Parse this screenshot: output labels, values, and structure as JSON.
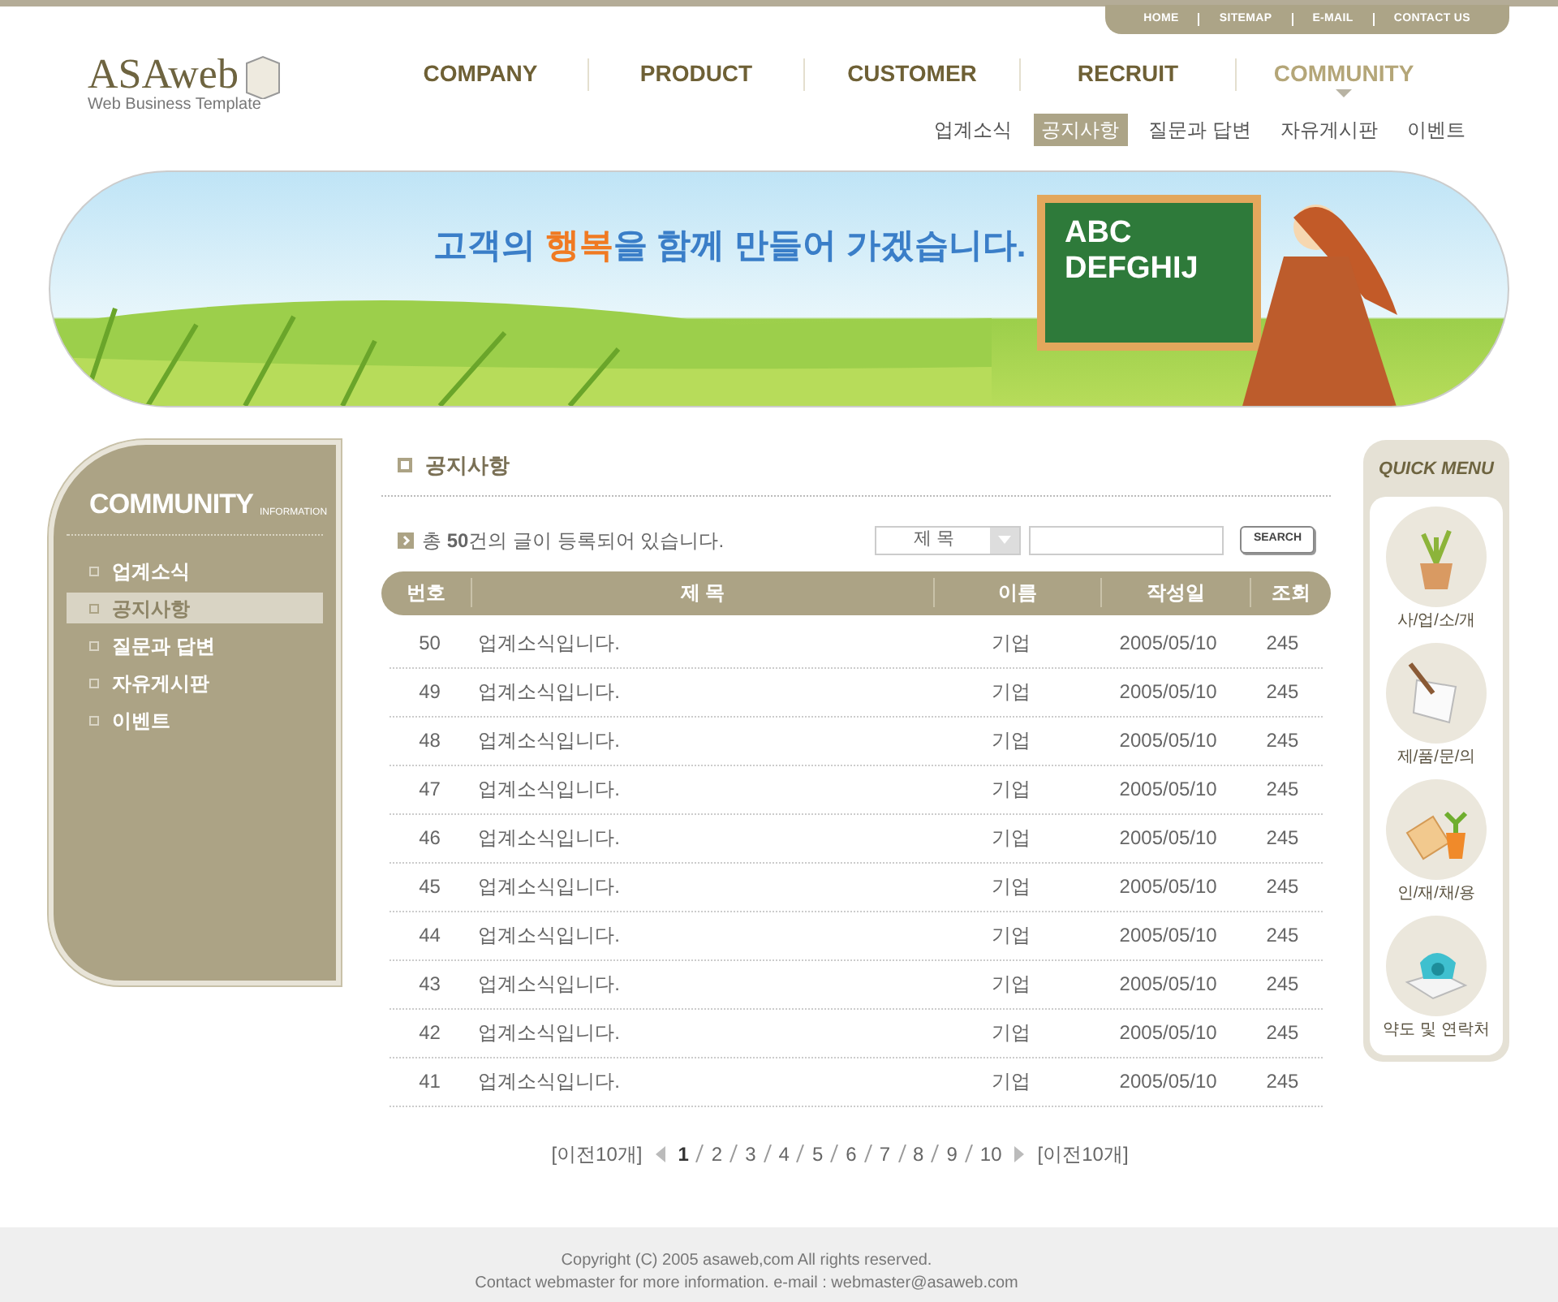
{
  "top_links": [
    "HOME",
    "SITEMAP",
    "E-MAIL",
    "CONTACT US"
  ],
  "logo": {
    "name": "ASAweb",
    "tagline": "Web Business Template"
  },
  "nav": [
    {
      "label": "COMPANY",
      "selected": false
    },
    {
      "label": "PRODUCT",
      "selected": false
    },
    {
      "label": "CUSTOMER",
      "selected": false
    },
    {
      "label": "RECRUIT",
      "selected": false
    },
    {
      "label": "COMMUNITY",
      "selected": true
    }
  ],
  "subnav": [
    {
      "label": "업계소식",
      "selected": false
    },
    {
      "label": "공지사항",
      "selected": true
    },
    {
      "label": "질문과 답변",
      "selected": false
    },
    {
      "label": "자유게시판",
      "selected": false
    },
    {
      "label": "이벤트",
      "selected": false
    }
  ],
  "banner": {
    "headline": [
      {
        "text": "고객의 ",
        "highlight": false
      },
      {
        "text": "행복",
        "highlight": true
      },
      {
        "text": "을 함께 만들어 가겠습니다.",
        "highlight": false
      }
    ],
    "board_lines": [
      "ABC",
      "DEFGHIJ"
    ]
  },
  "sidebar": {
    "title": "COMMUNITY",
    "subtitle": "INFORMATION",
    "items": [
      {
        "label": "업계소식",
        "selected": false
      },
      {
        "label": "공지사항",
        "selected": true
      },
      {
        "label": "질문과 답변",
        "selected": false
      },
      {
        "label": "자유게시판",
        "selected": false
      },
      {
        "label": "이벤트",
        "selected": false
      }
    ]
  },
  "board": {
    "title": "공지사항",
    "summary": "총 **50**건의 글이 등록되어 있습니다.",
    "search_select": "제 목",
    "search_button": "SEARCH",
    "columns": [
      "번호",
      "제 목",
      "이름",
      "작성일",
      "조회"
    ],
    "rows": [
      [
        "50",
        "업계소식입니다.",
        "기업",
        "2005/05/10",
        "245"
      ],
      [
        "49",
        "업계소식입니다.",
        "기업",
        "2005/05/10",
        "245"
      ],
      [
        "48",
        "업계소식입니다.",
        "기업",
        "2005/05/10",
        "245"
      ],
      [
        "47",
        "업계소식입니다.",
        "기업",
        "2005/05/10",
        "245"
      ],
      [
        "46",
        "업계소식입니다.",
        "기업",
        "2005/05/10",
        "245"
      ],
      [
        "45",
        "업계소식입니다.",
        "기업",
        "2005/05/10",
        "245"
      ],
      [
        "44",
        "업계소식입니다.",
        "기업",
        "2005/05/10",
        "245"
      ],
      [
        "43",
        "업계소식입니다.",
        "기업",
        "2005/05/10",
        "245"
      ],
      [
        "42",
        "업계소식입니다.",
        "기업",
        "2005/05/10",
        "245"
      ],
      [
        "41",
        "업계소식입니다.",
        "기업",
        "2005/05/10",
        "245"
      ]
    ],
    "pagination": {
      "prev": "[이전10개]",
      "next": "[이전10개]",
      "pages": [
        {
          "label": "1",
          "selected": true
        },
        {
          "label": "2",
          "selected": false
        },
        {
          "label": "3",
          "selected": false
        },
        {
          "label": "4",
          "selected": false
        },
        {
          "label": "5",
          "selected": false
        },
        {
          "label": "6",
          "selected": false
        },
        {
          "label": "7",
          "selected": false
        },
        {
          "label": "8",
          "selected": false
        },
        {
          "label": "9",
          "selected": false
        },
        {
          "label": "10",
          "selected": false
        }
      ]
    }
  },
  "quick_menu": {
    "title": "QUICK MENU",
    "items": [
      {
        "label": "사/업/소/개",
        "kind": "plant"
      },
      {
        "label": "제/품/문/의",
        "kind": "paper"
      },
      {
        "label": "인/재/채/용",
        "kind": "book"
      },
      {
        "label": "약도 및 연락처",
        "kind": "phone"
      }
    ]
  },
  "footer": [
    "Copyright (C) 2005 asaweb,com All rights reserved.",
    "Contact webmaster for more information.  e-mail : webmaster@asaweb.com"
  ]
}
